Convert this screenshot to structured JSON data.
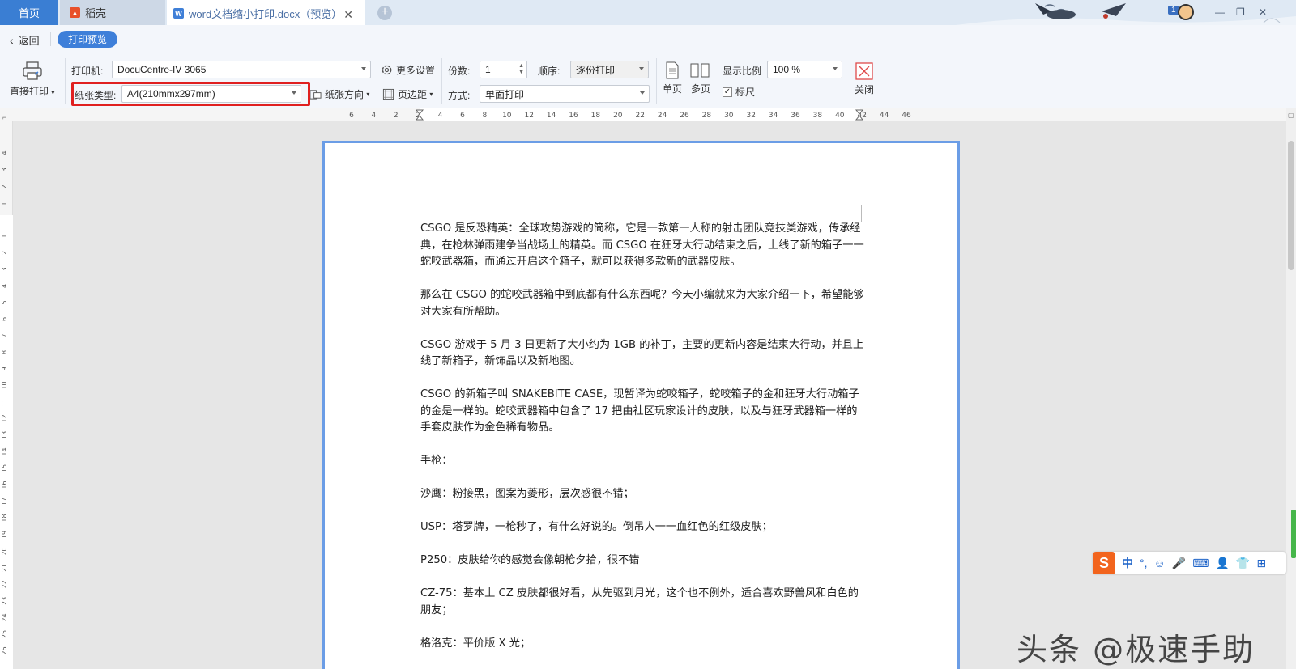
{
  "tabs": [
    {
      "label": "首页"
    },
    {
      "label": "稻壳",
      "icon": "daoke-logo-icon"
    },
    {
      "label": "word文档缩小打印.docx（预览）",
      "icon": "wps-writer-icon"
    }
  ],
  "window": {
    "badge": "1"
  },
  "subbar": {
    "back_label": "返回",
    "mode_label": "打印预览"
  },
  "ribbon": {
    "direct_print_label": "直接打印",
    "printer_label": "打印机:",
    "printer_value": "DocuCentre-IV 3065",
    "more_settings_label": "更多设置",
    "paper_type_label": "纸张类型:",
    "paper_type_value": "A4(210mmx297mm)",
    "orientation_label": "纸张方向",
    "margins_label": "页边距",
    "copies_label": "份数:",
    "copies_value": "1",
    "order_label": "顺序:",
    "order_value": "逐份打印",
    "method_label": "方式:",
    "method_value": "单面打印",
    "single_page_label": "单页",
    "multi_page_label": "多页",
    "zoom_label": "显示比例",
    "zoom_value": "100 %",
    "ruler_label": "标尺",
    "ruler_checked": true,
    "close_label": "关闭"
  },
  "ruler": {
    "h_ticks": [
      "6",
      "4",
      "2",
      "2",
      "4",
      "6",
      "8",
      "10",
      "12",
      "14",
      "16",
      "18",
      "20",
      "22",
      "24",
      "26",
      "28",
      "30",
      "32",
      "34",
      "36",
      "38",
      "40",
      "42",
      "44",
      "46"
    ],
    "v_ticks_top": [
      "4",
      "3",
      "2",
      "1"
    ],
    "v_ticks": [
      "1",
      "2",
      "3",
      "4",
      "5",
      "6",
      "7",
      "8",
      "9",
      "10",
      "11",
      "12",
      "13",
      "14",
      "15",
      "16",
      "17",
      "18",
      "19",
      "20",
      "21",
      "22",
      "23",
      "24",
      "25",
      "26"
    ]
  },
  "document": {
    "paragraphs": [
      "CSGO 是反恐精英：全球攻势游戏的简称，它是一款第一人称的射击团队竞技类游戏，传承经典，在枪林弹雨建争当战场上的精英。而 CSGO 在狂牙大行动结束之后，上线了新的箱子一一蛇咬武器箱，而通过开启这个箱子，就可以获得多款新的武器皮肤。",
      "那么在 CSGO 的蛇咬武器箱中到底都有什么东西呢？今天小编就来为大家介绍一下，希望能够对大家有所帮助。",
      "CSGO 游戏于 5 月 3 日更新了大小约为 1GB 的补丁，主要的更新内容是结束大行动，并且上线了新箱子，新饰品以及新地图。",
      "CSGO 的新箱子叫 SNAKEBITE CASE，现暂译为蛇咬箱子，蛇咬箱子的金和狂牙大行动箱子的金是一样的。蛇咬武器箱中包含了 17 把由社区玩家设计的皮肤，以及与狂牙武器箱一样的手套皮肤作为金色稀有物品。",
      "手枪：",
      "沙鹰：粉接黑，图案为菱形，层次感很不错；",
      "USP：塔罗牌，一枪秒了，有什么好说的。倒吊人一一血红色的红级皮肤；",
      "P250：皮肤给你的感觉会像朝枪夕拾，很不错",
      "CZ-75：基本上 CZ 皮肤都很好看，从先驱到月光，这个也不例外，适合喜欢野兽风和白色的朋友；",
      "格洛克：平价版 X 光；"
    ]
  },
  "ime": {
    "items": [
      "中",
      "°,",
      "☺",
      "🎤",
      "⌨",
      "👤",
      "👕",
      "⊞"
    ]
  },
  "watermark": "头条 @极速手助",
  "colors": {
    "accent": "#3e7fd9",
    "highlight": "#e02020",
    "page_border": "#6b9de6"
  }
}
